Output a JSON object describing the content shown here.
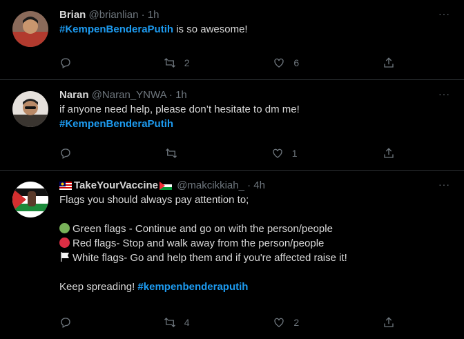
{
  "tweets": [
    {
      "name": "Brian",
      "handle": "@brianlian",
      "dot": "·",
      "time": "1h",
      "text_hashtag": "#KempenBenderaPutih",
      "text_rest": " is so awesome!",
      "reply_count": "",
      "retweet_count": "2",
      "like_count": "6"
    },
    {
      "name": "Naran",
      "handle": "@Naran_YNWA",
      "dot": "·",
      "time": "1h",
      "line1": "if anyone need help, please don’t hesitate to dm me!",
      "hashtag": "#KempenBenderaPutih",
      "reply_count": "",
      "retweet_count": "",
      "like_count": "1"
    },
    {
      "name": "TakeYourVaccine",
      "handle": "@makcikkiah_",
      "dot": "·",
      "time": "4h",
      "intro": "Flags you should always pay attention to;",
      "green": "Green flags - Continue and go on with the person/people",
      "red": "Red flags- Stop and walk away from the person/people",
      "white": "White flags- Go and help them and if you're affected raise it!",
      "closing_text": "Keep spreading! ",
      "closing_hashtag": "#kempenbenderaputih",
      "reply_count": "",
      "retweet_count": "4",
      "like_count": "2"
    }
  ],
  "more_label": "···",
  "colors": {
    "hashtag": "#1d9bf0",
    "muted": "#6e767d",
    "divider": "#2f3336"
  }
}
